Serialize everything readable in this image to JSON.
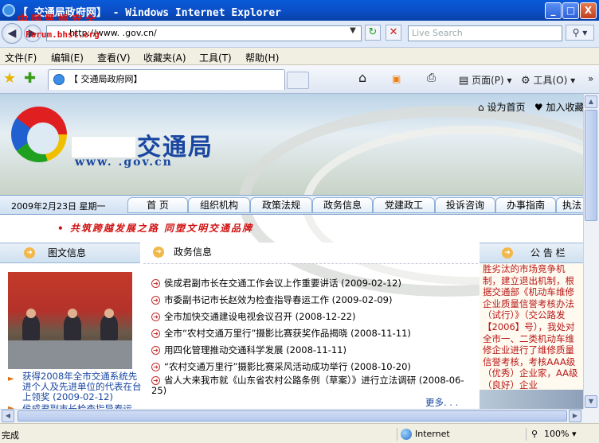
{
  "window": {
    "title": "【 交通局政府网】 - Windows Internet Explorer",
    "watermark_line1": "中国黑帽安全",
    "watermark_line2": "Forum.bhst.org",
    "minimize": "_",
    "maximize": "□",
    "close": "X"
  },
  "address_bar": {
    "url": "http://www.    .gov.cn/",
    "search_placeholder": "Live Search"
  },
  "menu": [
    "文件(F)",
    "编辑(E)",
    "查看(V)",
    "收藏夹(A)",
    "工具(T)",
    "帮助(H)"
  ],
  "tab": {
    "label": "【 交通局政府网】"
  },
  "command_bar": {
    "page": "页面(P)",
    "tools": "工具(O)"
  },
  "site": {
    "title": "交通局",
    "url": "www.    .gov.cn",
    "top_links": [
      "设为首页",
      "加入收藏"
    ],
    "date": "2009年2月23日  星期一",
    "nav": [
      "首 页",
      "组织机构",
      "政策法规",
      "政务信息",
      "党建政工",
      "投诉咨询",
      "办事指南",
      "执法"
    ],
    "slogan": "• 共筑跨越发展之路  同塑文明交通品牌"
  },
  "left_panel": {
    "heading": "图文信息",
    "caption": "获得2008年全市交通系统先进个人及先进单位的代表在台上领奖 (2009-02-12)",
    "caption2": "侯成君副市长检查指导春运"
  },
  "center_panel": {
    "heading": "政务信息",
    "news": [
      {
        "title": "侯成君副市长在交通工作会议上作重要讲话",
        "date": "(2009-02-12)"
      },
      {
        "title": "市委副书记市长赵效为检查指导春运工作",
        "date": "(2009-02-09)"
      },
      {
        "title": "全市加快交通建设电视会议召开",
        "date": "(2008-12-22)"
      },
      {
        "title": "全市“农村交通万里行”摄影比赛获奖作品揭晓",
        "date": "(2008-11-11)"
      },
      {
        "title": "用四化管理推动交通科学发展",
        "date": "(2008-11-11)"
      },
      {
        "title": "“农村交通万里行”摄影比赛采风活动成功举行",
        "date": "(2008-10-20)"
      },
      {
        "title": "省人大来我市就《山东省农村公路条例（草案）》进行立法调研",
        "date": "(2008-06-25)"
      }
    ],
    "more": "更多. . ."
  },
  "right_panel": {
    "heading": "公 告 栏",
    "notice": "胜劣汰的市场竞争机制，建立退出机制，根据交通部《机动车维修企业质量信誉考核办法（试行）》（交公路发【2006】号），我处对全市一、二类机动车维修企业进行了维修质量信誉考核，考核AAA级（优秀）企业家，AA级（良好）企业"
  },
  "status": {
    "text": "完成",
    "zone": "Internet",
    "zoom": "100%"
  }
}
